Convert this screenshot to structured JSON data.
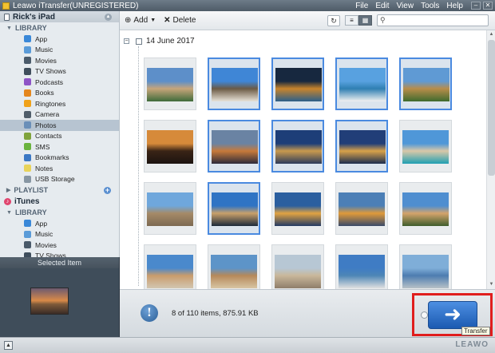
{
  "window": {
    "title": "Leawo iTransfer(UNREGISTERED)",
    "menu": [
      "File",
      "Edit",
      "View",
      "Tools",
      "Help"
    ]
  },
  "sidebar": {
    "device_name": "Rick's iPad",
    "device_library_label": "LIBRARY",
    "device_items": [
      {
        "label": "App",
        "icon": "app-icon",
        "color": "#3a88d8"
      },
      {
        "label": "Music",
        "icon": "music-icon",
        "color": "#5a9bd8"
      },
      {
        "label": "Movies",
        "icon": "movies-icon",
        "color": "#4a5a6a"
      },
      {
        "label": "TV Shows",
        "icon": "tv-icon",
        "color": "#3f4e5c"
      },
      {
        "label": "Podcasts",
        "icon": "podcast-icon",
        "color": "#8e54c6"
      },
      {
        "label": "Books",
        "icon": "books-icon",
        "color": "#e4861d"
      },
      {
        "label": "Ringtones",
        "icon": "ringtones-icon",
        "color": "#f0a21a"
      },
      {
        "label": "Camera",
        "icon": "camera-icon",
        "color": "#4f5d6a"
      },
      {
        "label": "Photos",
        "icon": "photos-icon",
        "color": "#6a8fb8",
        "selected": true
      },
      {
        "label": "Contacts",
        "icon": "contacts-icon",
        "color": "#7fa33c"
      },
      {
        "label": "SMS",
        "icon": "sms-icon",
        "color": "#6ab33e"
      },
      {
        "label": "Bookmarks",
        "icon": "bookmarks-icon",
        "color": "#3b78c4"
      },
      {
        "label": "Notes",
        "icon": "notes-icon",
        "color": "#e8d35a"
      },
      {
        "label": "USB Storage",
        "icon": "usb-icon",
        "color": "#8796a3"
      }
    ],
    "playlist_label": "PLAYLIST",
    "itunes_label": "iTunes",
    "itunes_library_label": "LIBRARY",
    "itunes_items": [
      {
        "label": "App",
        "icon": "app-icon",
        "color": "#3a88d8"
      },
      {
        "label": "Music",
        "icon": "music-icon",
        "color": "#5a9bd8"
      },
      {
        "label": "Movies",
        "icon": "movies-icon",
        "color": "#4a5a6a"
      },
      {
        "label": "TV Shows",
        "icon": "tv-icon",
        "color": "#3f4e5c"
      }
    ]
  },
  "selected_panel": {
    "title": "Selected Item"
  },
  "toolbar": {
    "add_label": "Add",
    "delete_label": "Delete",
    "search_placeholder": ""
  },
  "content": {
    "group_date": "14 June 2017",
    "photos": [
      {
        "selected": false,
        "colors": [
          "#5d8fc9",
          "#c7a57a",
          "#3e6b3a"
        ]
      },
      {
        "selected": true,
        "colors": [
          "#3f86d6",
          "#6b5a44",
          "#e8e2d8"
        ]
      },
      {
        "selected": true,
        "colors": [
          "#17283f",
          "#c8842c",
          "#2b5f8a"
        ]
      },
      {
        "selected": true,
        "colors": [
          "#58a1e0",
          "#2f7fb2",
          "#f1f1f1"
        ]
      },
      {
        "selected": true,
        "colors": [
          "#5f9ad4",
          "#b88d4a",
          "#3f6b2e"
        ]
      },
      {
        "selected": false,
        "colors": [
          "#d68a3a",
          "#3a2416",
          "#1b1410"
        ]
      },
      {
        "selected": true,
        "colors": [
          "#6a83a3",
          "#c77a3a",
          "#2c2b3a"
        ]
      },
      {
        "selected": true,
        "colors": [
          "#1d3e78",
          "#c99a4e",
          "#2b3a5a"
        ]
      },
      {
        "selected": true,
        "colors": [
          "#213e78",
          "#d8a24a",
          "#1b2c4e"
        ]
      },
      {
        "selected": false,
        "colors": [
          "#4f97d8",
          "#d9c8a8",
          "#1f9fb2"
        ]
      },
      {
        "selected": false,
        "colors": [
          "#6fa7dc",
          "#a58a68",
          "#7d6a52"
        ]
      },
      {
        "selected": true,
        "colors": [
          "#2f74c4",
          "#c9a06a",
          "#1c2a3a"
        ]
      },
      {
        "selected": false,
        "colors": [
          "#2b5f9f",
          "#e1a342",
          "#233a63"
        ]
      },
      {
        "selected": false,
        "colors": [
          "#4c7fb6",
          "#e09a3a",
          "#3a4b6a"
        ]
      },
      {
        "selected": false,
        "colors": [
          "#4f8ed0",
          "#d5a46c",
          "#3f5d2c"
        ]
      },
      {
        "selected": false,
        "colors": [
          "#4a89cc",
          "#c99c6c",
          "#d2c6b1"
        ]
      },
      {
        "selected": false,
        "colors": [
          "#5d94c8",
          "#b6895a",
          "#d8c5a3"
        ]
      },
      {
        "selected": false,
        "colors": [
          "#b7c7d4",
          "#c9b79a",
          "#8f7e6a"
        ]
      },
      {
        "selected": false,
        "colors": [
          "#3f7cc4",
          "#4d86b6",
          "#e0e0e0"
        ]
      },
      {
        "selected": false,
        "colors": [
          "#7faed8",
          "#4d7cb0",
          "#b7c1c7"
        ]
      }
    ]
  },
  "status": {
    "text": "8 of 110 items, 875.91 KB",
    "transfer_tooltip": "Transfer"
  },
  "footer": {
    "brand": "LEAWO"
  }
}
